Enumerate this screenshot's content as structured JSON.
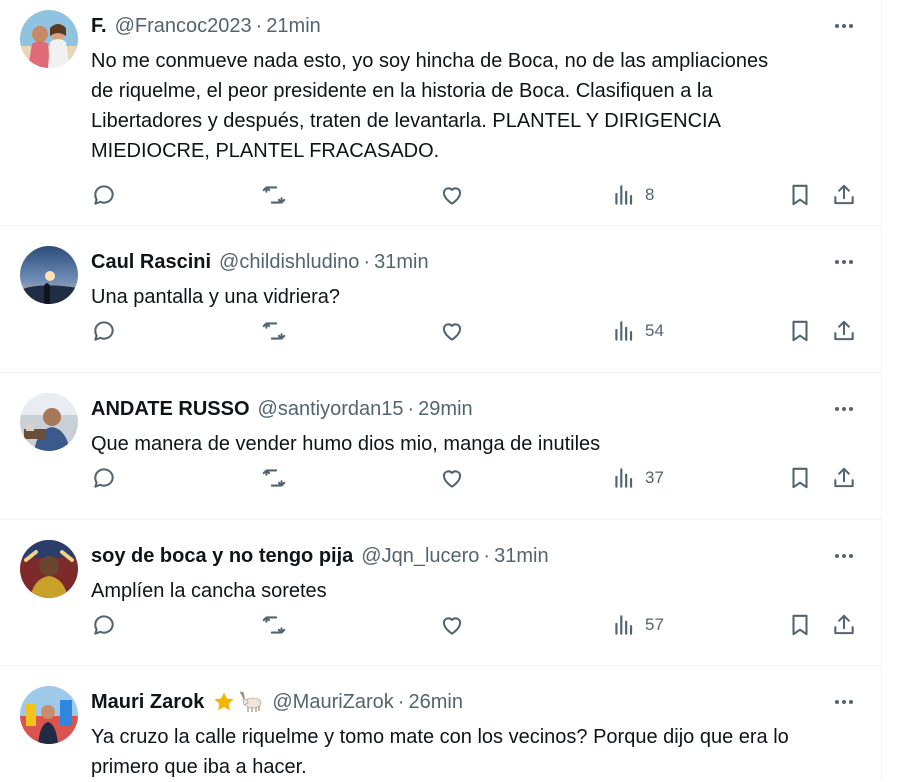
{
  "tweets": [
    {
      "name": "F.",
      "handle": "@Francoc2023",
      "dot": "·",
      "time": "21min",
      "text": "No me conmueve nada esto, yo soy hincha de Boca, no de las ampliaciones\nde riquelme, el peor presidente en la historia de Boca. Clasifiquen a la\nLibertadores y después, traten de levantarla. PLANTEL Y DIRIGENCIA\nMIEDIOCRE, PLANTEL FRACASADO.",
      "views": "8"
    },
    {
      "name": "Caul Rascini",
      "handle": "@childishludino",
      "dot": "·",
      "time": "31min",
      "text": "Una pantalla y una vidriera?",
      "views": "54"
    },
    {
      "name": "ANDATE RUSSO",
      "handle": "@santiyordan15",
      "dot": "·",
      "time": "29min",
      "text": "Que manera de vender humo dios mio, manga de inutiles",
      "views": "37"
    },
    {
      "name": "soy de boca y no tengo pija",
      "handle": "@Jqn_lucero",
      "dot": "·",
      "time": "31min",
      "text": "Amplíen la cancha soretes",
      "views": "57"
    },
    {
      "name": "Mauri Zarok",
      "handle": "@MauriZarok",
      "dot": "·",
      "time": "26min",
      "text": "Ya cruzo la calle riquelme y tomo mate con los vecinos? Porque dijo que era lo\nprimero que iba a hacer.",
      "badges": [
        "star-emoji",
        "goat-emoji"
      ]
    }
  ],
  "colors": {
    "text_primary": "#0f1419",
    "text_secondary": "#536471",
    "divider": "#eff3f4",
    "star": "#f4b400"
  },
  "icons": [
    "reply-icon",
    "retweet-icon",
    "like-icon",
    "views-icon",
    "bookmark-icon",
    "share-icon",
    "more-icon"
  ]
}
